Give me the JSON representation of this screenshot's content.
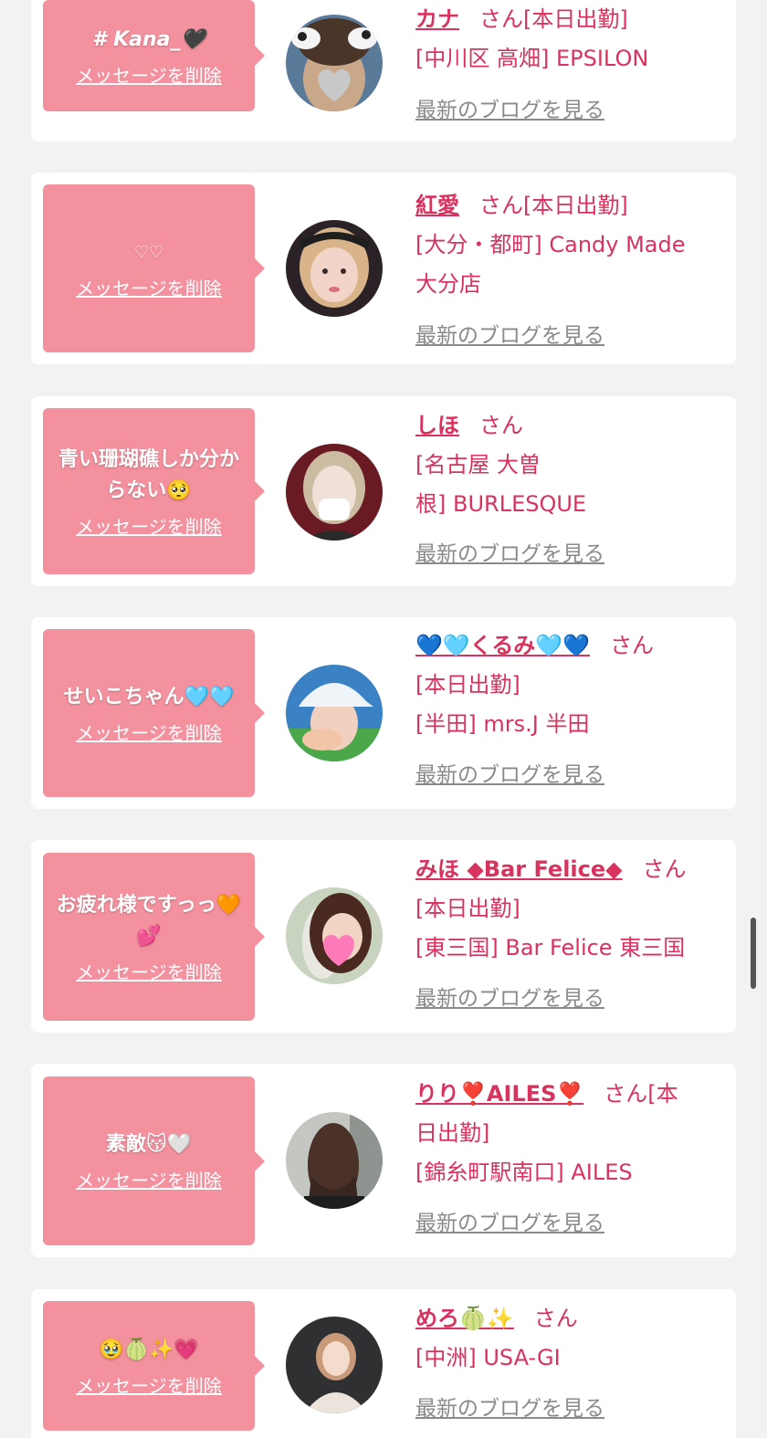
{
  "delete_label": "メッセージを削除",
  "blog_label": "最新のブログを見る",
  "san_label": "さん",
  "colors": {
    "background": "#f2f2f2",
    "bubble": "#f4919f",
    "name": "#d8335e",
    "blog_link": "#8a8a8a"
  },
  "items": [
    {
      "message": "# Kana_🖤",
      "name": "カナ",
      "after_san": "[本日出勤]",
      "lines": [
        "[中川区 高畑] EPSILON"
      ],
      "avatar_icon": "avatar-photo-cow-ears"
    },
    {
      "message": "♡♡",
      "name": "紅愛",
      "after_san": "[本日出勤]",
      "lines": [
        "[大分・都町] Candy Made",
        "大分店"
      ],
      "avatar_icon": "avatar-photo-blonde"
    },
    {
      "message": "青い珊瑚礁しか分からない🥺",
      "name": "しほ",
      "after_san": "",
      "lines": [
        "[名古屋 大曽",
        "根] BURLESQUE"
      ],
      "avatar_icon": "avatar-photo-mask"
    },
    {
      "message": "せいこちゃん🩵🩵",
      "name": "💙🩵くるみ🩵💙",
      "after_san": "",
      "lines": [
        "[本日出勤]",
        "[半田] mrs.J 半田"
      ],
      "avatar_icon": "avatar-photo-cap"
    },
    {
      "message": "お疲れ様ですっっ🧡💕",
      "name": "みほ ◆Bar Felice◆",
      "after_san": "",
      "lines": [
        "[本日出勤]",
        "[東三国] Bar Felice 東三国"
      ],
      "avatar_icon": "avatar-photo-heart"
    },
    {
      "message": "素敵😽🤍",
      "name": "りり❣️AILES❣️",
      "after_san": "[本",
      "lines": [
        "日出勤]",
        "[錦糸町駅南口] AILES"
      ],
      "avatar_icon": "avatar-photo-hair"
    },
    {
      "message": "🥹🍈✨💗",
      "name": "めろ🍈✨",
      "after_san": "",
      "lines": [
        "[中洲] USA-GI"
      ],
      "avatar_icon": "avatar-photo-dark"
    }
  ]
}
